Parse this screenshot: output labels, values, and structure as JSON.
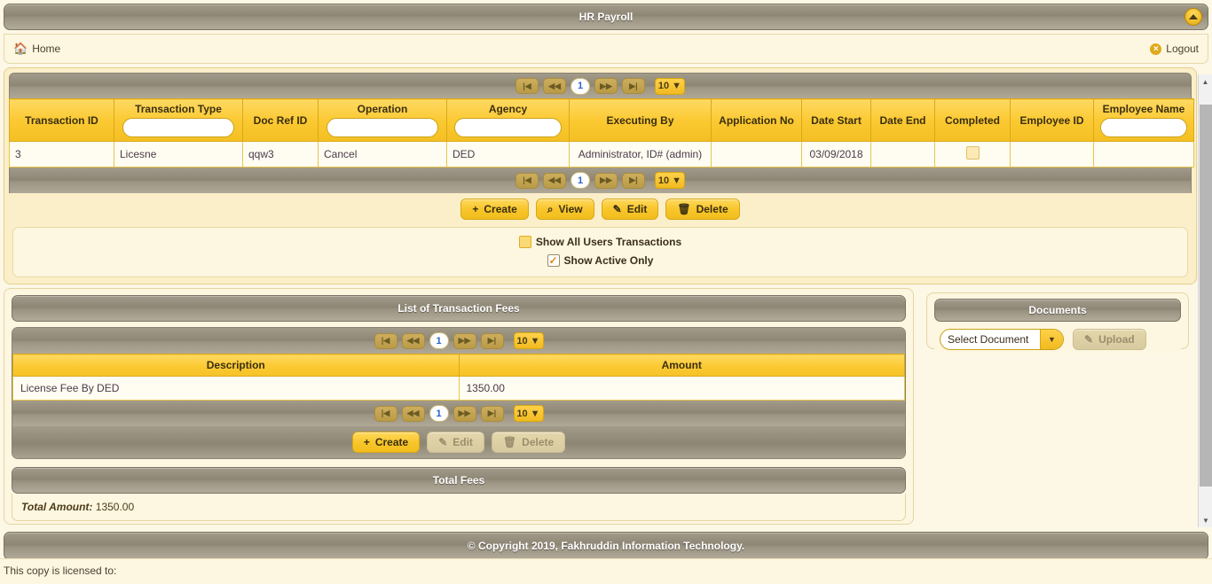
{
  "header": {
    "title": "HR Payroll",
    "collapse_icon": "triangle-up-icon"
  },
  "nav": {
    "home_label": "Home",
    "home_icon": "home-icon",
    "logout_label": "Logout",
    "logout_icon": "close-circle-icon"
  },
  "pager": {
    "first": "|◀",
    "prev": "◀◀",
    "page": "1",
    "next": "▶▶",
    "last": "▶|",
    "page_size": "10",
    "caret": "▼"
  },
  "transactions": {
    "columns": [
      {
        "label": "Transaction ID",
        "filter": false
      },
      {
        "label": "Transaction Type",
        "filter": true,
        "filter_value": ""
      },
      {
        "label": "Doc Ref ID",
        "filter": false
      },
      {
        "label": "Operation",
        "filter": true,
        "filter_value": ""
      },
      {
        "label": "Agency",
        "filter": true,
        "filter_value": ""
      },
      {
        "label": "Executing By",
        "filter": false
      },
      {
        "label": "Application No",
        "filter": false
      },
      {
        "label": "Date Start",
        "filter": false
      },
      {
        "label": "Date End",
        "filter": false
      },
      {
        "label": "Completed",
        "filter": false
      },
      {
        "label": "Employee ID",
        "filter": false
      },
      {
        "label": "Employee Name",
        "filter": true,
        "filter_value": ""
      }
    ],
    "rows": [
      {
        "transaction_id": "3",
        "transaction_type": "Licesne",
        "doc_ref_id": "qqw3",
        "operation": "Cancel",
        "agency": "DED",
        "executing_by": "Administrator, ID# (admin)",
        "application_no": "",
        "date_start": "03/09/2018",
        "date_end": "",
        "completed": false,
        "employee_id": "",
        "employee_name": ""
      }
    ],
    "buttons": [
      {
        "label": "Create",
        "icon": "plus-icon",
        "glyph": "+",
        "disabled": false
      },
      {
        "label": "View",
        "icon": "magnifier-icon",
        "glyph": "⌕",
        "disabled": false
      },
      {
        "label": "Edit",
        "icon": "pencil-icon",
        "glyph": "✎",
        "disabled": false
      },
      {
        "label": "Delete",
        "icon": "trash-icon",
        "glyph": "🗑",
        "disabled": false
      }
    ],
    "options": [
      {
        "label": "Show All Users Transactions",
        "checked": false
      },
      {
        "label": "Show Active Only",
        "checked": true
      }
    ]
  },
  "fees": {
    "title": "List of Transaction Fees",
    "columns": [
      "Description",
      "Amount"
    ],
    "rows": [
      {
        "description": "License Fee By DED",
        "amount": "1350.00"
      }
    ],
    "buttons": [
      {
        "label": "Create",
        "icon": "plus-icon",
        "glyph": "+",
        "disabled": false
      },
      {
        "label": "Edit",
        "icon": "pencil-icon",
        "glyph": "✎",
        "disabled": true
      },
      {
        "label": "Delete",
        "icon": "trash-icon",
        "glyph": "🗑",
        "disabled": true
      }
    ]
  },
  "total_fees": {
    "title": "Total Fees",
    "amount_label": "Total Amount:",
    "amount_value": "1350.00"
  },
  "documents": {
    "title": "Documents",
    "select_value": "Select Document",
    "select_caret": "▼",
    "upload_label": "Upload",
    "upload_icon": "pencil-icon",
    "upload_glyph": "✎",
    "upload_disabled": true
  },
  "footer": {
    "copyright": "© Copyright 2019, Fakhruddin Information Technology.",
    "license_text": "This copy is licensed to:"
  },
  "scrollbar": {
    "up_arrow": "▲",
    "down_arrow": "▼"
  }
}
